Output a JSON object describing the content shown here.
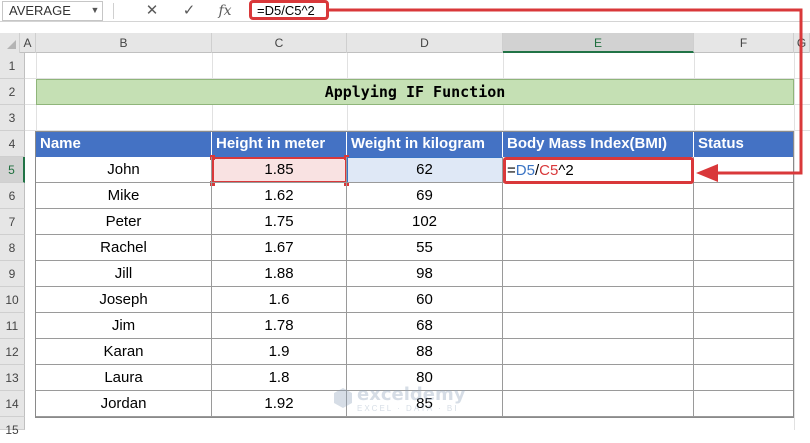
{
  "formula_bar": {
    "name_box": "AVERAGE",
    "cancel_glyph": "✕",
    "enter_glyph": "✓",
    "fx_label": "fx",
    "formula": "=D5/C5^2"
  },
  "columns": [
    "A",
    "B",
    "C",
    "D",
    "E",
    "F",
    "G"
  ],
  "rows": [
    "1",
    "2",
    "3",
    "4",
    "5",
    "6",
    "7",
    "8",
    "9",
    "10",
    "11",
    "12",
    "13",
    "14",
    "15"
  ],
  "title": "Applying IF Function",
  "table": {
    "headers": [
      "Name",
      "Height in meter",
      "Weight in kilogram",
      "Body Mass Index(BMI)",
      "Status"
    ],
    "rows": [
      {
        "name": "John",
        "height": "1.85",
        "weight": "62"
      },
      {
        "name": "Mike",
        "height": "1.62",
        "weight": "69"
      },
      {
        "name": "Peter",
        "height": "1.75",
        "weight": "102"
      },
      {
        "name": "Rachel",
        "height": "1.67",
        "weight": "55"
      },
      {
        "name": "Jill",
        "height": "1.88",
        "weight": "98"
      },
      {
        "name": "Joseph",
        "height": "1.6",
        "weight": "60"
      },
      {
        "name": "Jim",
        "height": "1.78",
        "weight": "68"
      },
      {
        "name": "Karan",
        "height": "1.9",
        "weight": "88"
      },
      {
        "name": "Laura",
        "height": "1.8",
        "weight": "80"
      },
      {
        "name": "Jordan",
        "height": "1.92",
        "weight": "85"
      }
    ]
  },
  "editing_cell": {
    "eq": "=",
    "ref1": "D5",
    "op": "/",
    "ref2": "C5",
    "tail": "^2"
  },
  "watermark": {
    "name": "exceldemy",
    "sub": "EXCEL · DATA · BI"
  },
  "colors": {
    "accent": "#d9383a",
    "header": "#4472c4",
    "title_fill": "#c5e0b4",
    "ref_blue": "#3a74c4"
  }
}
